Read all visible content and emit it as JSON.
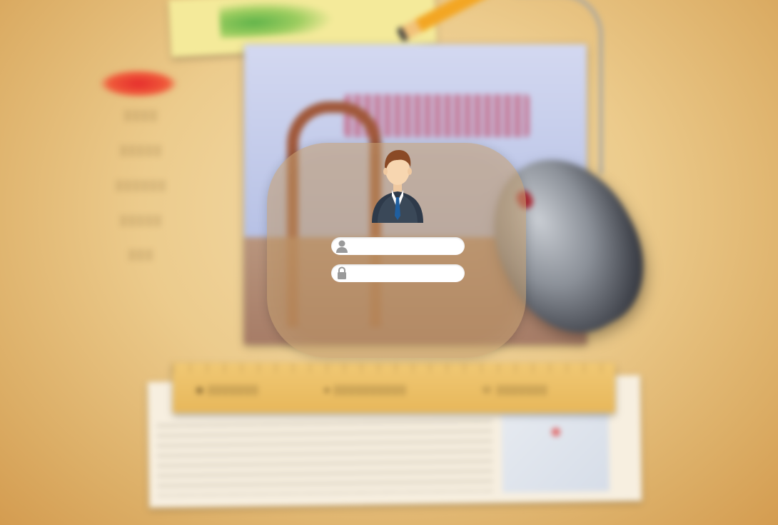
{
  "colors": {
    "background": "#eccb8c",
    "card": "#be9664",
    "icon_gray": "#9a9a9a",
    "tie": "#1f5fa0",
    "suit": "#2e3a4a"
  },
  "login": {
    "username_icon": "user-icon",
    "password_icon": "lock-icon",
    "username_placeholder": "",
    "password_placeholder": ""
  }
}
